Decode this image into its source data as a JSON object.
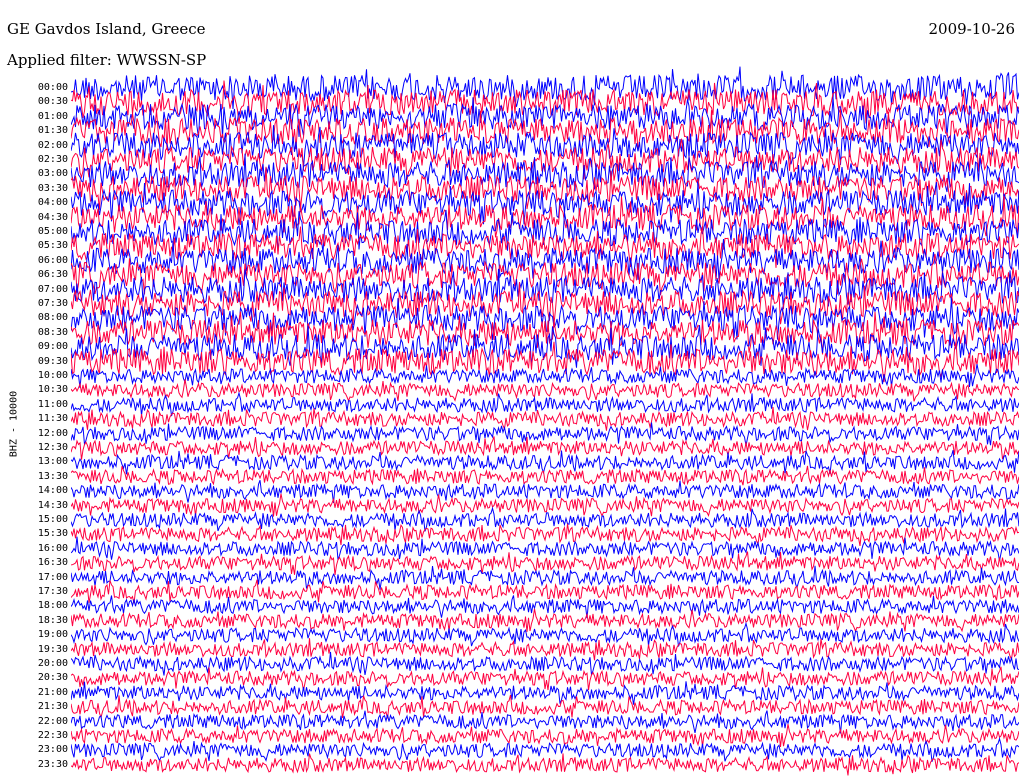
{
  "header": {
    "station": "GE Gavdos Island, Greece",
    "date": "2009-10-26",
    "filter": "Applied filter: WWSSN-SP"
  },
  "chart_data": {
    "type": "line",
    "title": "GE Gavdos Island, Greece",
    "date": "2009-10-26",
    "filter": "Applied filter: WWSSN-SP",
    "ylabel": "BHZ - 10000",
    "row_labels": [
      "00:00",
      "00:30",
      "01:00",
      "01:30",
      "02:00",
      "02:30",
      "03:00",
      "03:30",
      "04:00",
      "04:30",
      "05:00",
      "05:30",
      "06:00",
      "06:30",
      "07:00",
      "07:30",
      "08:00",
      "08:30",
      "09:00",
      "09:30",
      "10:00",
      "10:30",
      "11:00",
      "11:30",
      "12:00",
      "12:30",
      "13:00",
      "13:30",
      "14:00",
      "14:30",
      "15:00",
      "15:30",
      "16:00",
      "16:30",
      "17:00",
      "17:30",
      "18:00",
      "18:30",
      "19:00",
      "19:30",
      "20:00",
      "20:30",
      "21:00",
      "21:30",
      "22:00",
      "22:30",
      "23:00",
      "23:30"
    ],
    "trace_colors": [
      "#0000ff",
      "#ff0040"
    ],
    "noise_amplitude": {
      "high_until": "10:00",
      "high": 1.0,
      "low": 0.55
    }
  }
}
